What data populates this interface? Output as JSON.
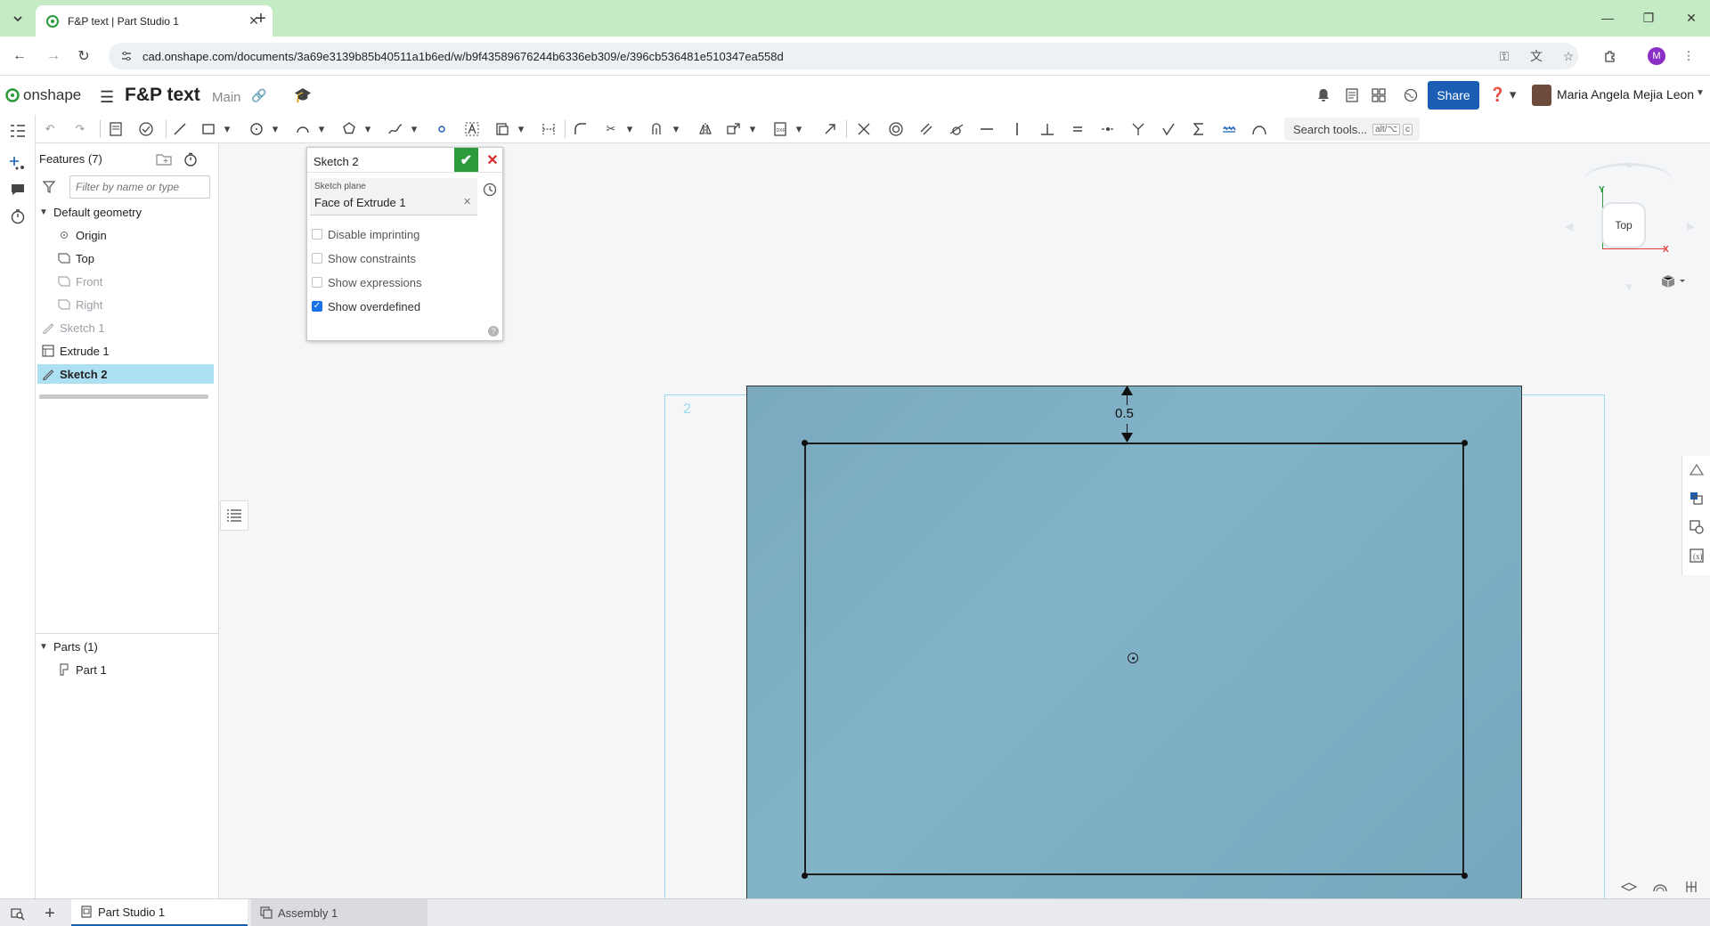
{
  "browser": {
    "tab_title": "F&P text | Part Studio 1",
    "url": "cad.onshape.com/documents/3a69e3139b85b40511a1b6ed/w/b9f43589676244b6336eb309/e/396cb536481e510347ea558d",
    "profile_initial": "M"
  },
  "header": {
    "logo_text": "onshape",
    "doc_title": "F&P text",
    "branch": "Main",
    "share_label": "Share",
    "user_name": "Maria Angela Mejia Leon"
  },
  "toolbar": {
    "search_label": "Search tools...",
    "shortcut_1": "alt/⌥",
    "shortcut_2": "c"
  },
  "features": {
    "header": "Features (7)",
    "filter_placeholder": "Filter by name or type",
    "default_geometry": "Default geometry",
    "items": [
      {
        "label": "Origin"
      },
      {
        "label": "Top"
      },
      {
        "label": "Front"
      },
      {
        "label": "Right"
      },
      {
        "label": "Sketch 1"
      },
      {
        "label": "Extrude 1"
      },
      {
        "label": "Sketch 2"
      }
    ],
    "parts_header": "Parts (1)",
    "part_1": "Part 1"
  },
  "sketch_dialog": {
    "title": "Sketch 2",
    "plane_label": "Sketch plane",
    "plane_value": "Face of Extrude 1",
    "options": [
      {
        "label": "Disable imprinting",
        "checked": false
      },
      {
        "label": "Show constraints",
        "checked": false
      },
      {
        "label": "Show expressions",
        "checked": false
      },
      {
        "label": "Show overdefined",
        "checked": true
      }
    ]
  },
  "viewport": {
    "plane_label": "2",
    "dimension_value": "0.5"
  },
  "view_cube": {
    "face_label": "Top",
    "axis_y": "Y",
    "axis_x": "X"
  },
  "bottom_tabs": [
    {
      "label": "Part Studio 1"
    },
    {
      "label": "Assembly 1"
    }
  ],
  "colors": {
    "accent": "#1a5fb4",
    "face_fill": "#7aa9c0",
    "selection": "#aee0f4",
    "ok_green": "#2b9a3a"
  }
}
